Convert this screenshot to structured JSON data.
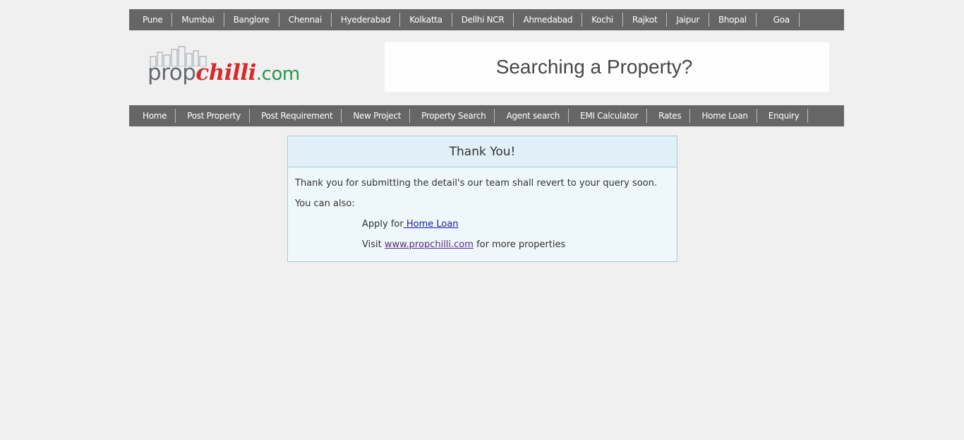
{
  "cities": [
    "Pune",
    "Mumbai",
    "Banglore",
    "Chennai",
    "Hyederabad",
    "Kolkatta",
    "Dellhi NCR",
    "Ahmedabad",
    "Kochi",
    "Rajkot",
    "Jaipur",
    "Bhopal",
    "Goa"
  ],
  "logo": {
    "part1": "prop",
    "part2": "chilli",
    "part3": ".com"
  },
  "banner": {
    "text": "Searching a Property?"
  },
  "nav": [
    "Home",
    "Post Property",
    "Post Requirement",
    "New Project",
    "Property Search",
    "Agent search",
    "EMI Calculator",
    "Rates",
    "Home Loan",
    "Enquiry"
  ],
  "thankyou": {
    "title": "Thank You!",
    "message": "Thank you for submitting the detail's our team shall revert to your query soon.",
    "also": "You can also:",
    "apply_prefix": "Apply for",
    "apply_link": " Home Loan",
    "visit_prefix": "Visit ",
    "visit_link": "www.propchilli.com",
    "visit_suffix": " for more properties"
  }
}
